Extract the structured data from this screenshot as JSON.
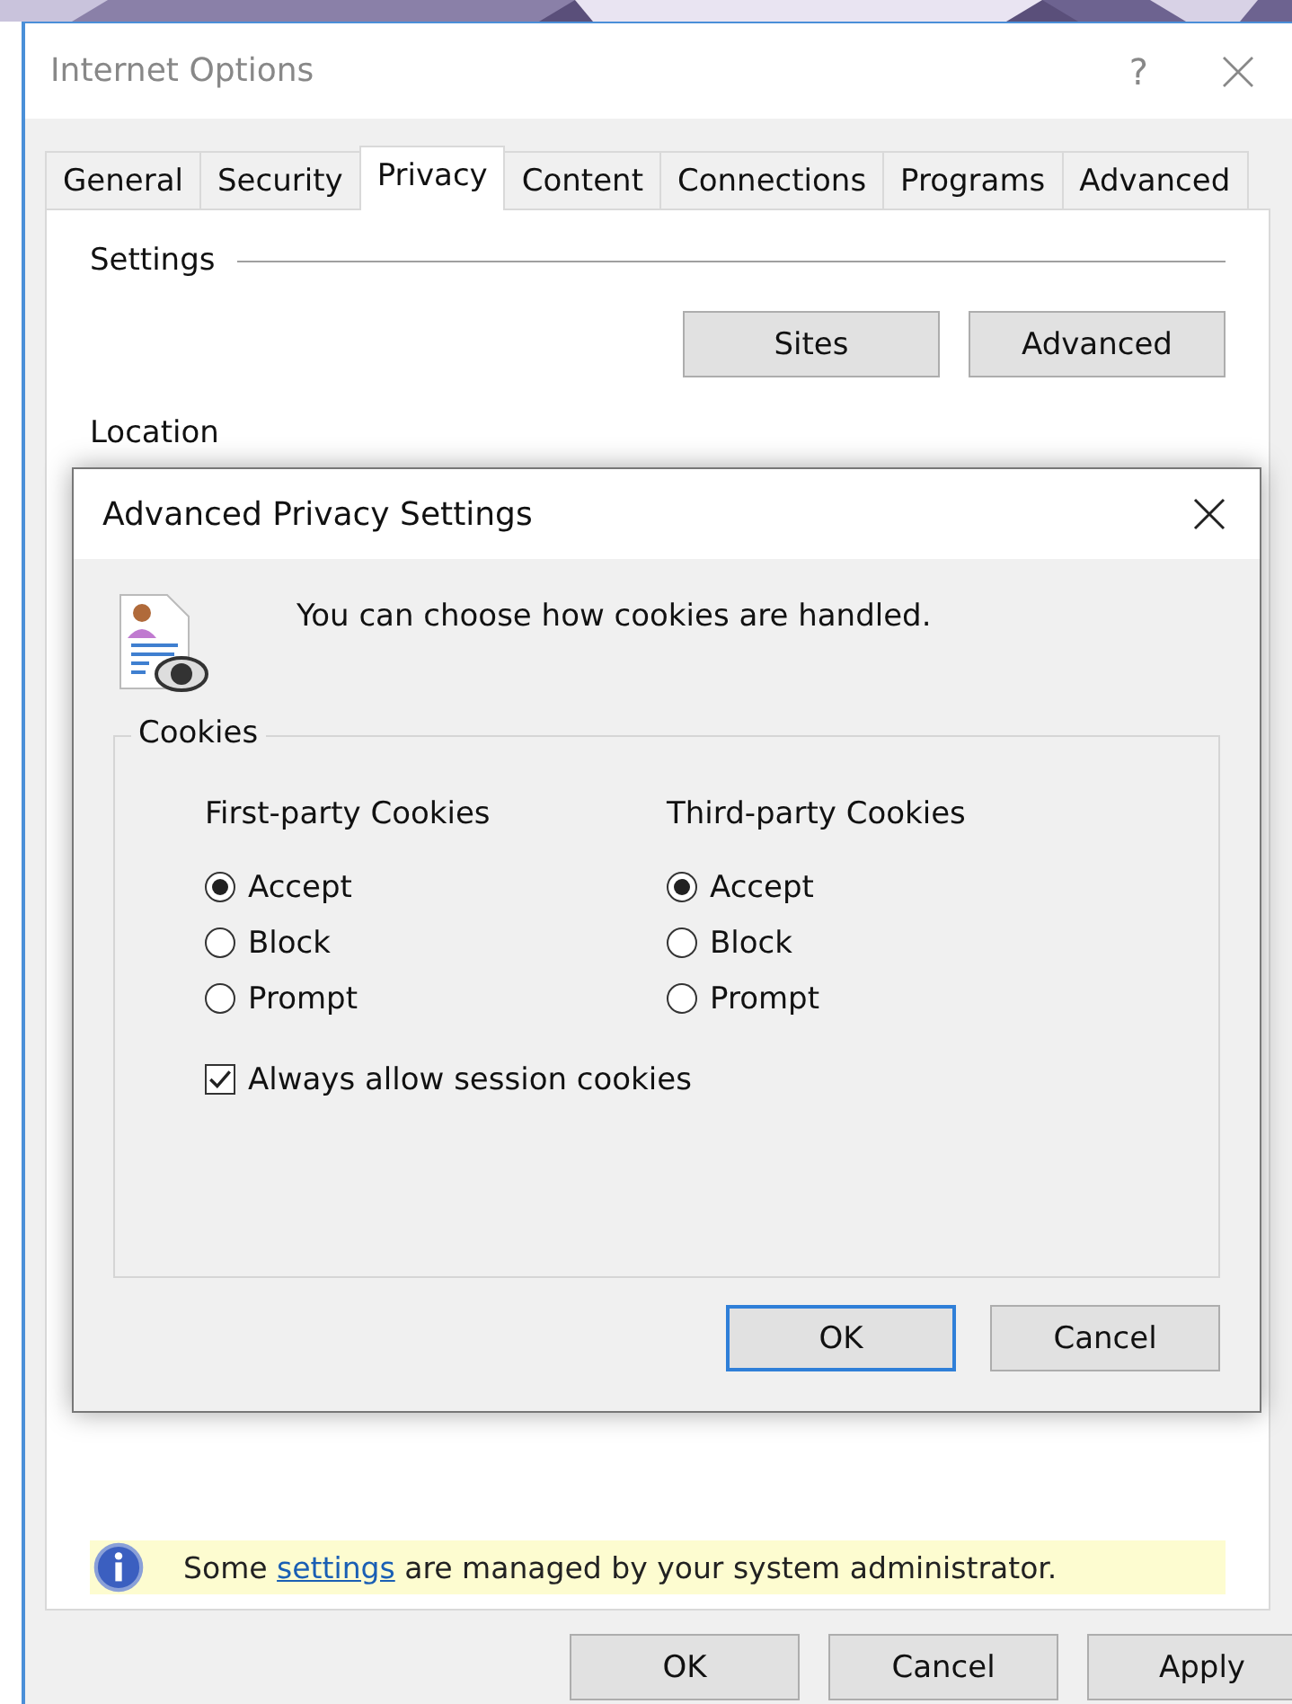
{
  "window": {
    "title": "Internet Options",
    "help": "?"
  },
  "tabs": [
    {
      "label": "General",
      "selected": false
    },
    {
      "label": "Security",
      "selected": false
    },
    {
      "label": "Privacy",
      "selected": true
    },
    {
      "label": "Content",
      "selected": false
    },
    {
      "label": "Connections",
      "selected": false
    },
    {
      "label": "Programs",
      "selected": false
    },
    {
      "label": "Advanced",
      "selected": false
    }
  ],
  "settings": {
    "heading": "Settings",
    "buttons": [
      "Sites",
      "Advanced"
    ]
  },
  "location": {
    "heading": "Location"
  },
  "notice": {
    "before": "Some ",
    "link": "settings",
    "after": " are managed by your system administrator."
  },
  "buttons": [
    "OK",
    "Cancel",
    "Apply"
  ],
  "dialog": {
    "title": "Advanced Privacy Settings",
    "message": "You can choose how cookies are handled.",
    "group": "Cookies",
    "columns": [
      {
        "heading": "First-party Cookies",
        "options": [
          {
            "label": "Accept",
            "selected": true
          },
          {
            "label": "Block",
            "selected": false
          },
          {
            "label": "Prompt",
            "selected": false
          }
        ]
      },
      {
        "heading": "Third-party Cookies",
        "options": [
          {
            "label": "Accept",
            "selected": true
          },
          {
            "label": "Block",
            "selected": false
          },
          {
            "label": "Prompt",
            "selected": false
          }
        ]
      }
    ],
    "session": {
      "label": "Always allow session cookies",
      "checked": true
    },
    "buttons": [
      {
        "label": "OK",
        "default": true
      },
      {
        "label": "Cancel",
        "default": false
      }
    ]
  }
}
